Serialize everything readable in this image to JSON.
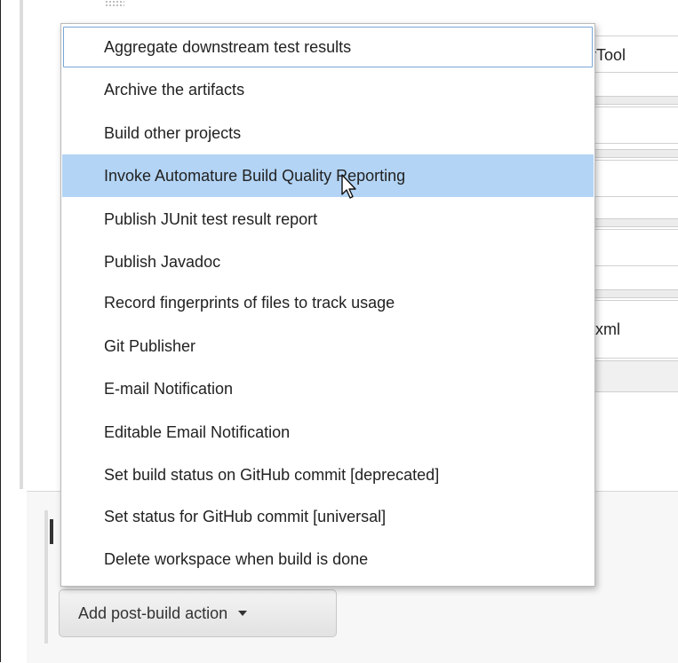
{
  "background": {
    "rows": [
      {
        "text": "erTool"
      },
      {
        "text": ""
      },
      {
        "text": ""
      },
      {
        "text": ""
      },
      {
        "text": "xml"
      }
    ]
  },
  "menu": {
    "items": [
      {
        "label": "Aggregate downstream test results",
        "state": "focused"
      },
      {
        "label": "Archive the artifacts"
      },
      {
        "label": "Build other projects"
      },
      {
        "label": "Invoke Automature Build Quality Reporting",
        "state": "hovered"
      },
      {
        "label": "Publish JUnit test result report"
      },
      {
        "label": "Publish Javadoc"
      },
      {
        "label": "Record fingerprints of files to track usage"
      },
      {
        "label": "Git Publisher"
      },
      {
        "label": "E-mail Notification"
      },
      {
        "label": "Editable Email Notification"
      },
      {
        "label": "Set build status on GitHub commit [deprecated]"
      },
      {
        "label": "Set status for GitHub commit [universal]"
      },
      {
        "label": "Delete workspace when build is done"
      }
    ]
  },
  "add_button": {
    "label": "Add post-build action"
  },
  "colors": {
    "hover": "#b3d4f5",
    "focus_outline": "#7aa7d6",
    "button_bg": "#e8e8e8"
  }
}
